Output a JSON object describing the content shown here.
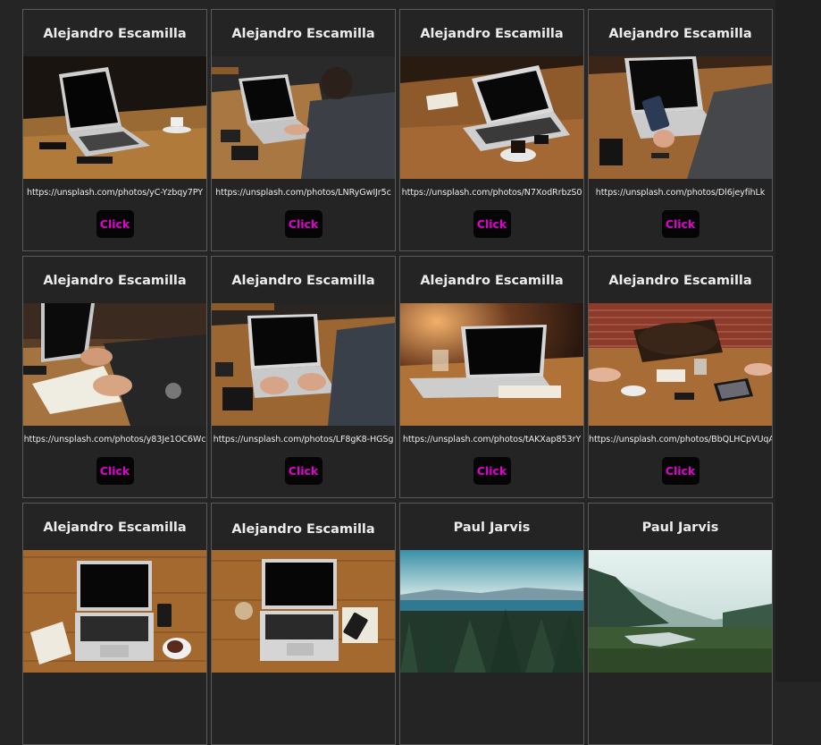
{
  "cards": [
    {
      "author": "Alejandro Escamilla",
      "url": "https://unsplash.com/photos/yC-Yzbqy7PY",
      "button": "Click",
      "photo": "laptop-on-wooden-table-with-coffee"
    },
    {
      "author": "Alejandro Escamilla",
      "url": "https://unsplash.com/photos/LNRyGwIJr5c",
      "button": "Click",
      "photo": "man-typing-on-laptop"
    },
    {
      "author": "Alejandro Escamilla",
      "url": "https://unsplash.com/photos/N7XodRrbzS0",
      "button": "Click",
      "photo": "laptop-notebook-coffee-topdown"
    },
    {
      "author": "Alejandro Escamilla",
      "url": "https://unsplash.com/photos/Dl6jeyfihLk",
      "button": "Click",
      "photo": "man-holding-phone-at-laptop"
    },
    {
      "author": "Alejandro Escamilla",
      "url": "https://unsplash.com/photos/y83Je1OC6Wc",
      "button": "Click",
      "photo": "hands-writing-in-notebook"
    },
    {
      "author": "Alejandro Escamilla",
      "url": "https://unsplash.com/photos/LF8gK8-HGSg",
      "button": "Click",
      "photo": "hands-on-laptop-keyboard"
    },
    {
      "author": "Alejandro Escamilla",
      "url": "https://unsplash.com/photos/tAKXap853rY",
      "button": "Click",
      "photo": "laptop-with-glass-warm-light"
    },
    {
      "author": "Alejandro Escamilla",
      "url": "https://unsplash.com/photos/BbQLHCpVUqA",
      "button": "Click",
      "photo": "desk-with-bag-tablet-brick-wall"
    },
    {
      "author": "Alejandro Escamilla",
      "photo": "laptop-topdown-notebook-coffee"
    },
    {
      "author": "Alejandro Escamilla",
      "photo": "laptop-topdown-glass-phone"
    },
    {
      "author": "Paul Jarvis",
      "photo": "forest-and-lake-landscape"
    },
    {
      "author": "Paul Jarvis",
      "photo": "misty-valley-river"
    }
  ]
}
